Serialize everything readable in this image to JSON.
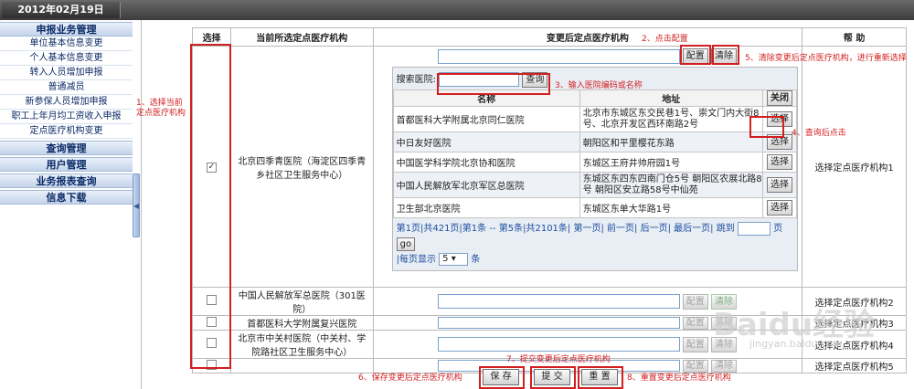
{
  "top_bar": {
    "date": "2012年02月19日"
  },
  "sidebar": {
    "sections": [
      {
        "title": "申报业务管理",
        "items": [
          "单位基本信息变更",
          "个人基本信息变更",
          "转入人员增加申报",
          "普通减员",
          "新参保人员增加申报",
          "职工上年月均工资收入申报",
          "定点医疗机构变更"
        ]
      },
      {
        "title": "查询管理",
        "items": []
      },
      {
        "title": "用户管理",
        "items": []
      },
      {
        "title": "业务报表查询",
        "items": []
      },
      {
        "title": "信息下载",
        "items": []
      }
    ]
  },
  "table": {
    "headers": {
      "select": "选择",
      "current": "当前所选定点医疗机构",
      "changed": "变更后定点医疗机构",
      "help": "帮 助"
    },
    "buttons": {
      "config": "配置",
      "clear": "清除"
    },
    "rows": [
      {
        "checked": true,
        "current": "北京四季青医院（海淀区四季青乡社区卫生服务中心）",
        "help": "选择定点医疗机构1"
      },
      {
        "checked": false,
        "current": "中国人民解放军总医院（301医院）",
        "help": "选择定点医疗机构2"
      },
      {
        "checked": false,
        "current": "首都医科大学附属复兴医院",
        "help": "选择定点医疗机构3"
      },
      {
        "checked": false,
        "current": "北京市中关村医院（中关村、学院路社区卫生服务中心）",
        "help": "选择定点医疗机构4"
      },
      {
        "checked": false,
        "current": "",
        "help": "选择定点医疗机构5"
      }
    ]
  },
  "search_panel": {
    "search_label": "搜索医院:",
    "search_button": "查询",
    "close_button": "关闭",
    "col_name": "名称",
    "col_address": "地址",
    "select_label": "选择",
    "results": [
      {
        "name": "首都医科大学附属北京同仁医院",
        "address": "北京市东城区东交民巷1号、崇文门内大街8号、北京开发区西环南路2号"
      },
      {
        "name": "中日友好医院",
        "address": "朝阳区和平里樱花东路"
      },
      {
        "name": "中国医学科学院北京协和医院",
        "address": "东城区王府井帅府园1号"
      },
      {
        "name": "中国人民解放军北京军区总医院",
        "address": "东城区东四东四南门仓5号 朝阳区农展北路8号 朝阳区安立路58号中仙苑"
      },
      {
        "name": "卫生部北京医院",
        "address": "东城区东单大华路1号"
      }
    ],
    "pager": {
      "summary": "第1页|共421页|第1条 -- 第5条|共2101条|",
      "first": "第一页",
      "prev": "前一页",
      "next": "后一页",
      "last": "最后一页",
      "jump_to": "跳到",
      "page_unit": "页",
      "go": "go",
      "per_page_label": "|每页显示",
      "per_page_value": "5",
      "per_page_unit": "条"
    }
  },
  "bottom_buttons": {
    "save": "保 存",
    "submit": "提 交",
    "reset": "重 置"
  },
  "annotations": {
    "a1": "1、选择当前\n定点医疗机构",
    "a2": "2、点击配置",
    "a3": "3、输入医院编码或名称",
    "a4": "4、查询后点击",
    "a5": "5、清除变更后定点医疗机构，进行重新选择",
    "a6": "6、保存变更后定点医疗机构",
    "a7": "7、提交变更后定点医疗机构",
    "a8": "8、重置变更后定点医疗机构"
  },
  "watermark": {
    "logo": "Baidu经验",
    "url": "jingyan.baidu.com"
  },
  "colors": {
    "annotation_red": "#d21f1f",
    "sidebar_text": "#0a2a66",
    "link_blue": "#1c4fa0"
  }
}
